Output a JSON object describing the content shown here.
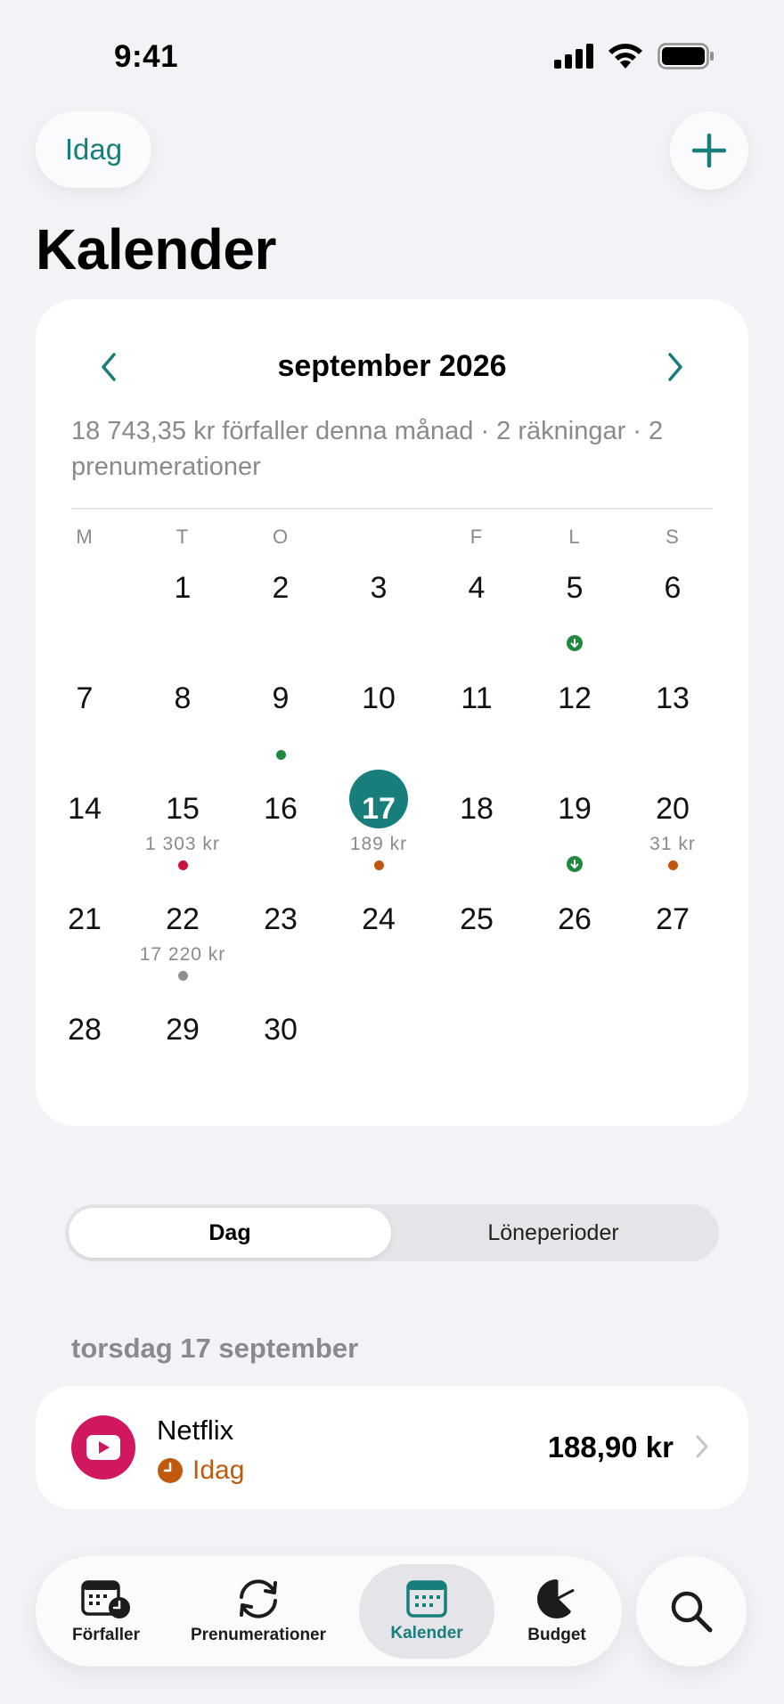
{
  "status_bar": {
    "time": "9:41"
  },
  "header": {
    "today_label": "Idag",
    "title": "Kalender"
  },
  "calendar": {
    "month_label": "september 2026",
    "summary": "18 743,35 kr förfaller denna månad · 2 räkningar · 2 prenumerationer",
    "weekdays": [
      "M",
      "T",
      "O",
      "",
      "F",
      "L",
      "S"
    ],
    "selected_day": 17,
    "days": [
      {
        "d": "1"
      },
      {
        "d": "2"
      },
      {
        "d": "3"
      },
      {
        "d": "4"
      },
      {
        "d": "5",
        "marker": "income"
      },
      {
        "d": "6"
      },
      {
        "d": "7"
      },
      {
        "d": "8"
      },
      {
        "d": "9",
        "marker": "green"
      },
      {
        "d": "10"
      },
      {
        "d": "11"
      },
      {
        "d": "12"
      },
      {
        "d": "13"
      },
      {
        "d": "14"
      },
      {
        "d": "15",
        "amount": "1 303 kr",
        "marker": "red"
      },
      {
        "d": "16"
      },
      {
        "d": "17",
        "amount": "189 kr",
        "marker": "orange"
      },
      {
        "d": "18"
      },
      {
        "d": "19",
        "marker": "income"
      },
      {
        "d": "20",
        "amount": "31 kr",
        "marker": "orange"
      },
      {
        "d": "21"
      },
      {
        "d": "22",
        "amount": "17 220 kr",
        "marker": "gray"
      },
      {
        "d": "23"
      },
      {
        "d": "24"
      },
      {
        "d": "25"
      },
      {
        "d": "26"
      },
      {
        "d": "27"
      },
      {
        "d": "28"
      },
      {
        "d": "29"
      },
      {
        "d": "30"
      }
    ],
    "marker_colors": {
      "green": "#1f8a3e",
      "income": "#1f8a3e",
      "red": "#d0103a",
      "orange": "#c0560f",
      "gray": "#8e8e93"
    }
  },
  "segmented": {
    "active_label": "Dag",
    "inactive_label": "Löneperioder"
  },
  "day_section": {
    "date_label": "torsdag 17 september",
    "items": [
      {
        "name": "Netflix",
        "status": "Idag",
        "amount": "188,90 kr",
        "icon": "play-icon"
      }
    ]
  },
  "tabbar": {
    "tabs": [
      {
        "label": "Förfaller",
        "icon": "calendar-clock-icon"
      },
      {
        "label": "Prenumerationer",
        "icon": "refresh-icon"
      },
      {
        "label": "Kalender",
        "icon": "calendar-icon",
        "active": true
      },
      {
        "label": "Budget",
        "icon": "pie-chart-icon"
      }
    ],
    "search_icon": "search-icon"
  },
  "colors": {
    "accent": "#177e7c",
    "background": "#f2f2f7",
    "netflix": "#d1175f",
    "warning": "#bf5a0f"
  }
}
